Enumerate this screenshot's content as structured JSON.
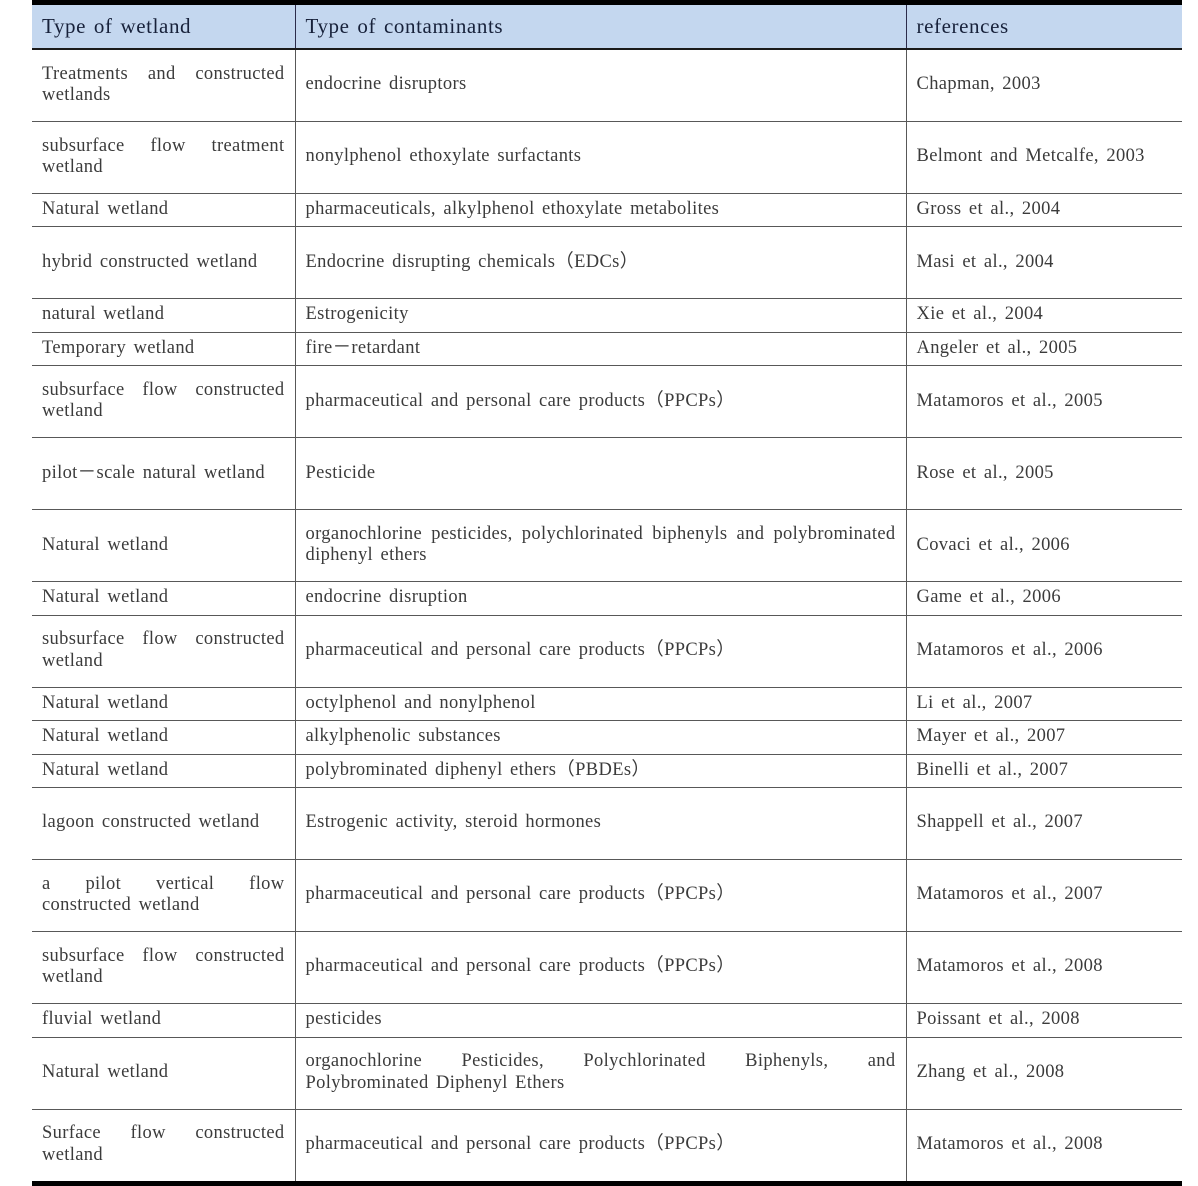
{
  "table": {
    "columns": [
      {
        "id": "wetland",
        "label": "Type of wetland"
      },
      {
        "id": "contaminants",
        "label": "Type of contaminants"
      },
      {
        "id": "references",
        "label": "references"
      }
    ],
    "header_background": "#c4d7ef",
    "header_text_color": "#17213a",
    "body_text_color": "#3b3b3b",
    "border_color": "#585858",
    "outer_border_color": "#000000",
    "rows": [
      {
        "wetland": "Treatments and constructed wetlands",
        "contaminants": "endocrine disruptors",
        "references": "Chapman, 2003",
        "lines": 2
      },
      {
        "wetland": "subsurface flow treatment wetland",
        "contaminants": "nonylphenol ethoxylate surfactants",
        "references": "Belmont and Metcalfe, 2003",
        "lines": 2
      },
      {
        "wetland": "Natural wetland",
        "contaminants": "pharmaceuticals, alkylphenol ethoxylate metabolites",
        "references": "Gross et al., 2004",
        "lines": 1
      },
      {
        "wetland": "hybrid constructed wetland",
        "contaminants": "Endocrine disrupting chemicals（EDCs）",
        "references": "Masi et al., 2004",
        "lines": 2
      },
      {
        "wetland": "natural wetland",
        "contaminants": "Estrogenicity",
        "references": "Xie et al., 2004",
        "lines": 1
      },
      {
        "wetland": "Temporary wetland",
        "contaminants": "fire－retardant",
        "references": "Angeler et al., 2005",
        "lines": 1
      },
      {
        "wetland": "subsurface flow constructed wetland",
        "contaminants": "pharmaceutical and personal care products（PPCPs）",
        "references": "Matamoros et al., 2005",
        "lines": 2
      },
      {
        "wetland": "pilot－scale natural wetland",
        "contaminants": "Pesticide",
        "references": "Rose et al., 2005",
        "lines": 2
      },
      {
        "wetland": "Natural wetland",
        "contaminants": "organochlorine pesticides, polychlorinated biphenyls and polybrominated diphenyl ethers",
        "references": "Covaci et al., 2006",
        "lines": 2
      },
      {
        "wetland": "Natural wetland",
        "contaminants": "endocrine disruption",
        "references": "Game et al., 2006",
        "lines": 1
      },
      {
        "wetland": "subsurface flow constructed wetland",
        "contaminants": "pharmaceutical and personal care products（PPCPs）",
        "references": "Matamoros et al., 2006",
        "lines": 2
      },
      {
        "wetland": "Natural wetland",
        "contaminants": "octylphenol and nonylphenol",
        "references": "Li et al., 2007",
        "lines": 1
      },
      {
        "wetland": "Natural wetland",
        "contaminants": "alkylphenolic substances",
        "references": "Mayer et al., 2007",
        "lines": 1
      },
      {
        "wetland": "Natural wetland",
        "contaminants": "polybrominated diphenyl ethers（PBDEs）",
        "references": "Binelli et al., 2007",
        "lines": 1
      },
      {
        "wetland": "lagoon constructed wetland",
        "contaminants": "Estrogenic activity, steroid hormones",
        "references": "Shappell et al., 2007",
        "lines": 2
      },
      {
        "wetland": "a pilot vertical flow constructed wetland",
        "contaminants": "pharmaceutical and personal care products（PPCPs）",
        "references": "Matamoros et al., 2007",
        "lines": 2
      },
      {
        "wetland": "subsurface flow constructed wetland",
        "contaminants": "pharmaceutical and personal care products（PPCPs）",
        "references": "Matamoros et al., 2008",
        "lines": 2
      },
      {
        "wetland": "fluvial wetland",
        "contaminants": "pesticides",
        "references": "Poissant et al., 2008",
        "lines": 1
      },
      {
        "wetland": "Natural wetland",
        "contaminants": "organochlorine Pesticides, Polychlorinated Biphenyls, and Polybrominated Diphenyl Ethers",
        "references": "Zhang et al., 2008",
        "lines": 2
      },
      {
        "wetland": "Surface flow constructed wetland",
        "contaminants": "pharmaceutical and personal care products（PPCPs）",
        "references": "Matamoros et al., 2008",
        "lines": 2
      }
    ]
  }
}
